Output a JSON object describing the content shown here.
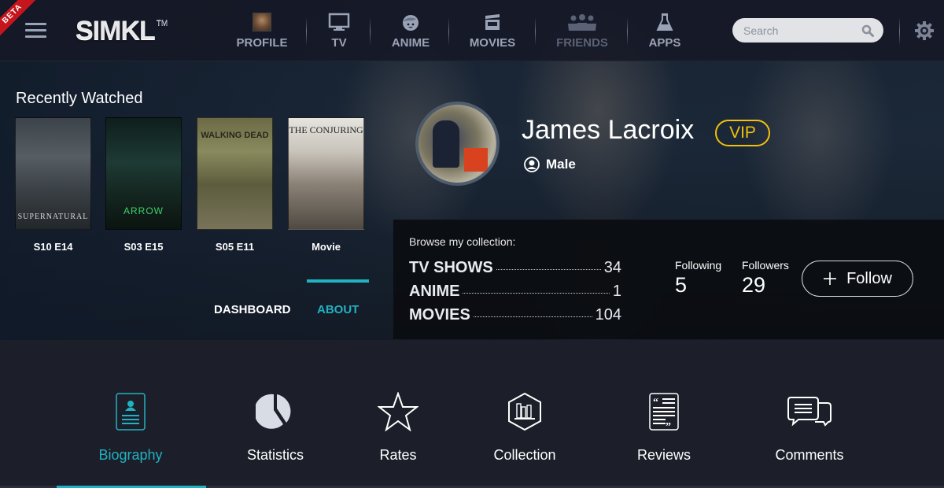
{
  "header": {
    "beta_label": "BETA",
    "logo": "SIMKL",
    "logo_tm": "TM",
    "nav": [
      {
        "label": "PROFILE",
        "icon": "profile-avatar-icon"
      },
      {
        "label": "TV",
        "icon": "tv-icon"
      },
      {
        "label": "ANIME",
        "icon": "anime-face-icon"
      },
      {
        "label": "MOVIES",
        "icon": "clapperboard-icon"
      },
      {
        "label": "FRIENDS",
        "icon": "friends-icon"
      },
      {
        "label": "APPS",
        "icon": "flask-icon"
      }
    ],
    "search_placeholder": "Search"
  },
  "recently_watched": {
    "title": "Recently Watched",
    "items": [
      {
        "title": "SUPERNATURAL",
        "label": "S10 E14"
      },
      {
        "title": "ARROW",
        "label": "S03 E15"
      },
      {
        "title": "WALKING DEAD",
        "label": "S05 E11"
      },
      {
        "title": "THE CONJURING",
        "label": "Movie"
      }
    ]
  },
  "profile": {
    "name": "James Lacroix",
    "badge": "VIP",
    "gender": "Male",
    "tabs": [
      {
        "label": "DASHBOARD",
        "active": false
      },
      {
        "label": "ABOUT",
        "active": true
      }
    ]
  },
  "collection": {
    "title": "Browse my collection:",
    "rows": [
      {
        "label": "TV SHOWS",
        "count": "34"
      },
      {
        "label": "ANIME",
        "count": "1"
      },
      {
        "label": "MOVIES",
        "count": "104"
      }
    ]
  },
  "social": {
    "following_label": "Following",
    "following": "5",
    "followers_label": "Followers",
    "followers": "29",
    "follow_button": "Follow"
  },
  "sections": [
    {
      "label": "Biography",
      "icon": "biography-icon",
      "active": true
    },
    {
      "label": "Statistics",
      "icon": "pie-chart-icon",
      "active": false
    },
    {
      "label": "Rates",
      "icon": "star-icon",
      "active": false
    },
    {
      "label": "Collection",
      "icon": "collection-icon",
      "active": false
    },
    {
      "label": "Reviews",
      "icon": "reviews-icon",
      "active": false
    },
    {
      "label": "Comments",
      "icon": "comments-icon",
      "active": false
    }
  ],
  "colors": {
    "accent": "#22b1c2",
    "vip": "#f2c10d",
    "beta": "#c4161c"
  }
}
